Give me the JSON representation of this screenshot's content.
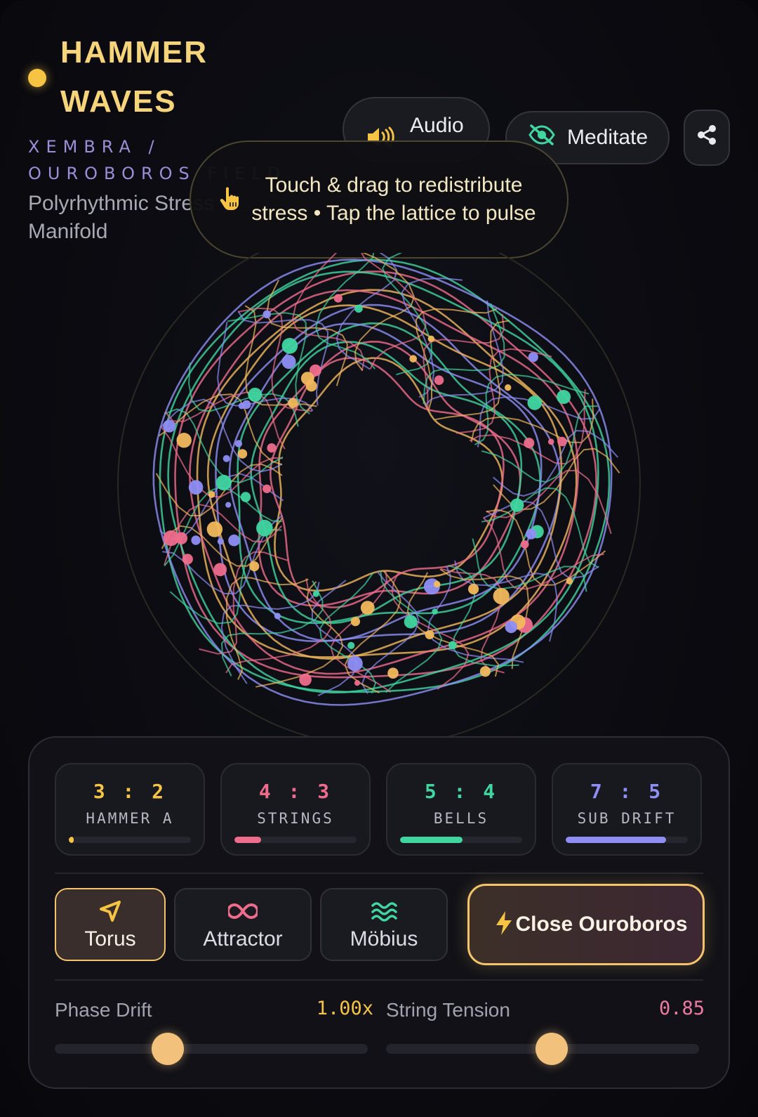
{
  "header": {
    "title_line1": "HAMMER",
    "title_line2": "WAVES",
    "subtitle": "XEMBRA / OUROBOROS FIELD",
    "description": "Polyrhythmic Stress Manifold",
    "brand_color": "#f6c343"
  },
  "toolbar": {
    "audio_label": "Audio",
    "meditate_label": "Meditate",
    "icons": [
      "volume-icon",
      "eye-slash-icon",
      "share-icon"
    ]
  },
  "tooltip": {
    "text": "Touch & drag to redistribute stress • Tap the lattice to pulse",
    "icon": "pointer-hand-icon"
  },
  "ratios": [
    {
      "ratio": "3 : 2",
      "name": "HAMMER A",
      "progress": 0.03,
      "color": "#f6c343"
    },
    {
      "ratio": "4 : 3",
      "name": "STRINGS",
      "progress": 0.22,
      "color": "#ef6d8c"
    },
    {
      "ratio": "5 : 4",
      "name": "BELLS",
      "progress": 0.51,
      "color": "#3fd6a0"
    },
    {
      "ratio": "7 : 5",
      "name": "SUB DRIFT",
      "progress": 0.82,
      "color": "#8f8ef5"
    }
  ],
  "modes": [
    {
      "label": "Torus",
      "icon": "send-icon",
      "active": true
    },
    {
      "label": "Attractor",
      "icon": "infinity-icon",
      "active": false
    },
    {
      "label": "Möbius",
      "icon": "waves-icon",
      "active": false
    }
  ],
  "cta": {
    "label": "Close Ouroboros",
    "icon": "bolt-icon"
  },
  "sliders": [
    {
      "label": "Phase Drift",
      "value_text": "1.00x",
      "level": 0.36,
      "color": "#f6c343"
    },
    {
      "label": "String Tension",
      "value_text": "0.85",
      "level": 0.53,
      "color": "#ef7aa0"
    }
  ],
  "palette": {
    "gold": "#f2b95c",
    "pink": "#ef6d8c",
    "teal": "#3fd6a0",
    "violet": "#8f8ef5"
  }
}
